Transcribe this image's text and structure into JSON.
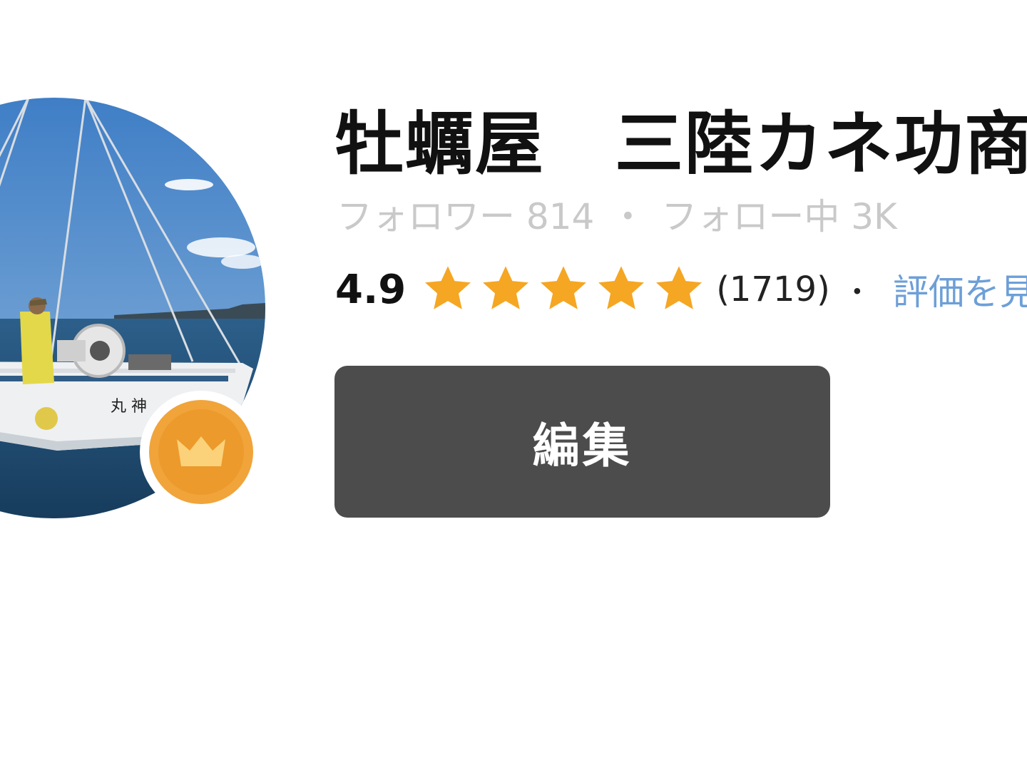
{
  "profile": {
    "name": "牡蠣屋　三陸カネ功商",
    "avatar_icon": "profile-photo-fishing-boat",
    "badge_icon": "crown-icon",
    "colors": {
      "badge": "#f0a43a",
      "star": "#f5a623",
      "link": "#6d9fd8",
      "button": "#4c4c4c"
    }
  },
  "follow": {
    "followers_label": "フォロワー",
    "followers_count": "814",
    "separator": "・",
    "following_label": "フォロー中",
    "following_count": "3K"
  },
  "rating": {
    "score": "4.9",
    "stars": 5,
    "count": "(1719)",
    "separator": "・",
    "link_label": "評価を見"
  },
  "actions": {
    "edit_label": "編集"
  }
}
